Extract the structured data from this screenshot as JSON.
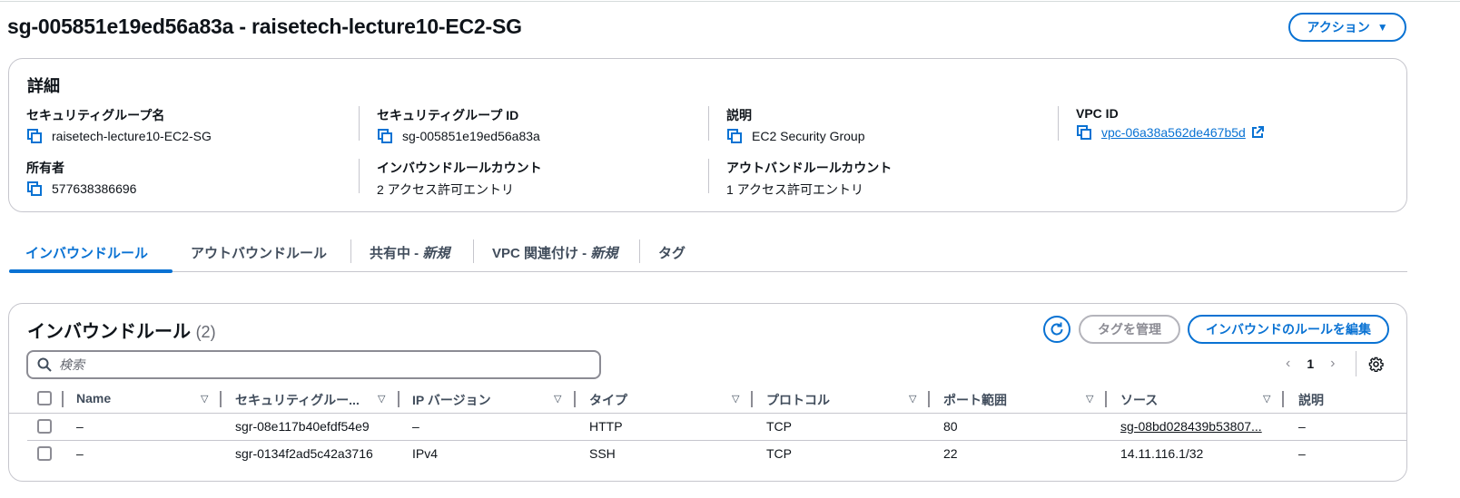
{
  "header": {
    "title": "sg-005851e19ed56a83a - raisetech-lecture10-EC2-SG",
    "actions_label": "アクション"
  },
  "details": {
    "title": "詳細",
    "sg_name_label": "セキュリティグループ名",
    "sg_name": "raisetech-lecture10-EC2-SG",
    "sg_id_label": "セキュリティグループ ID",
    "sg_id": "sg-005851e19ed56a83a",
    "description_label": "説明",
    "description": "EC2 Security Group",
    "vpc_label": "VPC ID",
    "vpc_id": "vpc-06a38a562de467b5d",
    "owner_label": "所有者",
    "owner": "577638386696",
    "inbound_count_label": "インバウンドルールカウント",
    "inbound_count": "2 アクセス許可エントリ",
    "outbound_count_label": "アウトバンドルールカウント",
    "outbound_count": "1 アクセス許可エントリ"
  },
  "tabs": [
    {
      "label": "インバウンドルール"
    },
    {
      "label": "アウトバウンドルール"
    },
    {
      "label": "共有中 - ",
      "em": "新規"
    },
    {
      "label": "VPC 関連付け - ",
      "em": "新規"
    },
    {
      "label": "タグ"
    }
  ],
  "rules": {
    "title": "インバウンドルール",
    "count": "(2)",
    "manage_tags_label": "タグを管理",
    "edit_label": "インバウンドのルールを編集",
    "search_placeholder": "検索",
    "page": "1",
    "columns": [
      "Name",
      "セキュリティグルー...",
      "IP バージョン",
      "タイプ",
      "プロトコル",
      "ポート範囲",
      "ソース",
      "説明"
    ],
    "rows": [
      {
        "name": "–",
        "rule_id": "sgr-08e117b40efdf54e9",
        "ip_version": "–",
        "type": "HTTP",
        "protocol": "TCP",
        "port": "80",
        "source": "sg-08bd028439b53807...",
        "description": "–"
      },
      {
        "name": "–",
        "rule_id": "sgr-0134f2ad5c42a3716",
        "ip_version": "IPv4",
        "type": "SSH",
        "protocol": "TCP",
        "port": "22",
        "source": "14.11.116.1/32",
        "description": "–"
      }
    ]
  },
  "colors": {
    "accent": "#0972d3",
    "text": "#0f141a",
    "border": "#c6c6cd"
  },
  "icons": [
    "copy-icon",
    "external-link-icon",
    "refresh-icon",
    "search-icon",
    "settings-icon",
    "chevron-left-icon",
    "chevron-right-icon",
    "caret-down-icon",
    "sort-icon"
  ]
}
